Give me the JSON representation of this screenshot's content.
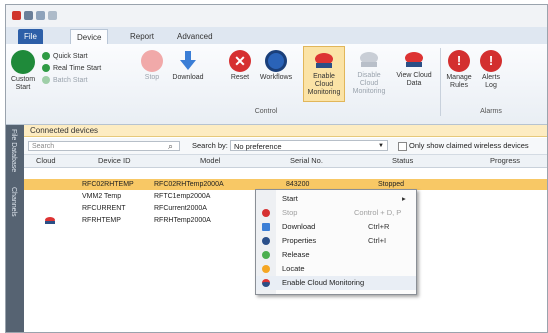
{
  "ribbon": {
    "tabs": [
      "File",
      "Device",
      "Report",
      "Advanced"
    ],
    "buttons": {
      "custom_start": "Custom Start",
      "quick_start": "Quick Start",
      "real_time_start": "Real Time Start",
      "batch_start": "Batch Start",
      "stop": "Stop",
      "download": "Download",
      "reset": "Reset",
      "workflows": "Workflows",
      "enable_cloud": "Enable Cloud Monitoring",
      "disable_cloud": "Disable Cloud Monitoring",
      "view_cloud": "View Cloud Data",
      "manage_rules": "Manage Rules",
      "alerts_log": "Alerts Log"
    },
    "groups": {
      "control": "Control",
      "alarms": "Alarms"
    }
  },
  "side_tabs": [
    "File Database",
    "Channels"
  ],
  "connected": {
    "title": "Connected devices",
    "search_placeholder": "Search",
    "search_by_label": "Search by:",
    "search_by_value": "No preference",
    "only_show_label": "Only show claimed wireless devices",
    "columns": [
      "Cloud",
      "Device ID",
      "Model",
      "Serial No.",
      "Status",
      "Progress"
    ],
    "rows": [
      {
        "device_id": "RFC02RHTEMP",
        "model": "RFC02RHTemp2000A",
        "serial": "843200",
        "status": "Stopped"
      },
      {
        "device_id": "VMM2 Temp",
        "model": "RFTC1emp2000A",
        "serial": "",
        "status": ""
      },
      {
        "device_id": "RFCURRENT",
        "model": "RFCurrent2000A",
        "serial": "",
        "status": ""
      },
      {
        "device_id": "RFRHTEMP",
        "model": "RFRHTemp2000A",
        "serial": "",
        "status": ""
      }
    ]
  },
  "context_menu": {
    "items": [
      {
        "label": "Start",
        "shortcut": "▸",
        "enabled": true,
        "icon": "start-arrow-icon"
      },
      {
        "label": "Stop",
        "shortcut": "Control + D, P",
        "enabled": false,
        "icon": "stop-icon"
      },
      {
        "label": "Download",
        "shortcut": "Ctrl+R",
        "enabled": true,
        "icon": "download-icon"
      },
      {
        "label": "Properties",
        "shortcut": "Ctrl+I",
        "enabled": true,
        "icon": "properties-icon"
      },
      {
        "label": "Release",
        "shortcut": "",
        "enabled": true,
        "icon": "release-icon"
      },
      {
        "label": "Locate",
        "shortcut": "",
        "enabled": true,
        "icon": "locate-icon"
      },
      {
        "label": "Enable Cloud Monitoring",
        "shortcut": "",
        "enabled": true,
        "icon": "cloud-icon"
      }
    ]
  },
  "colors": {
    "accent": "#2d5fa8",
    "selected_row": "#f8c865",
    "connected_header": "#fdecc2"
  }
}
